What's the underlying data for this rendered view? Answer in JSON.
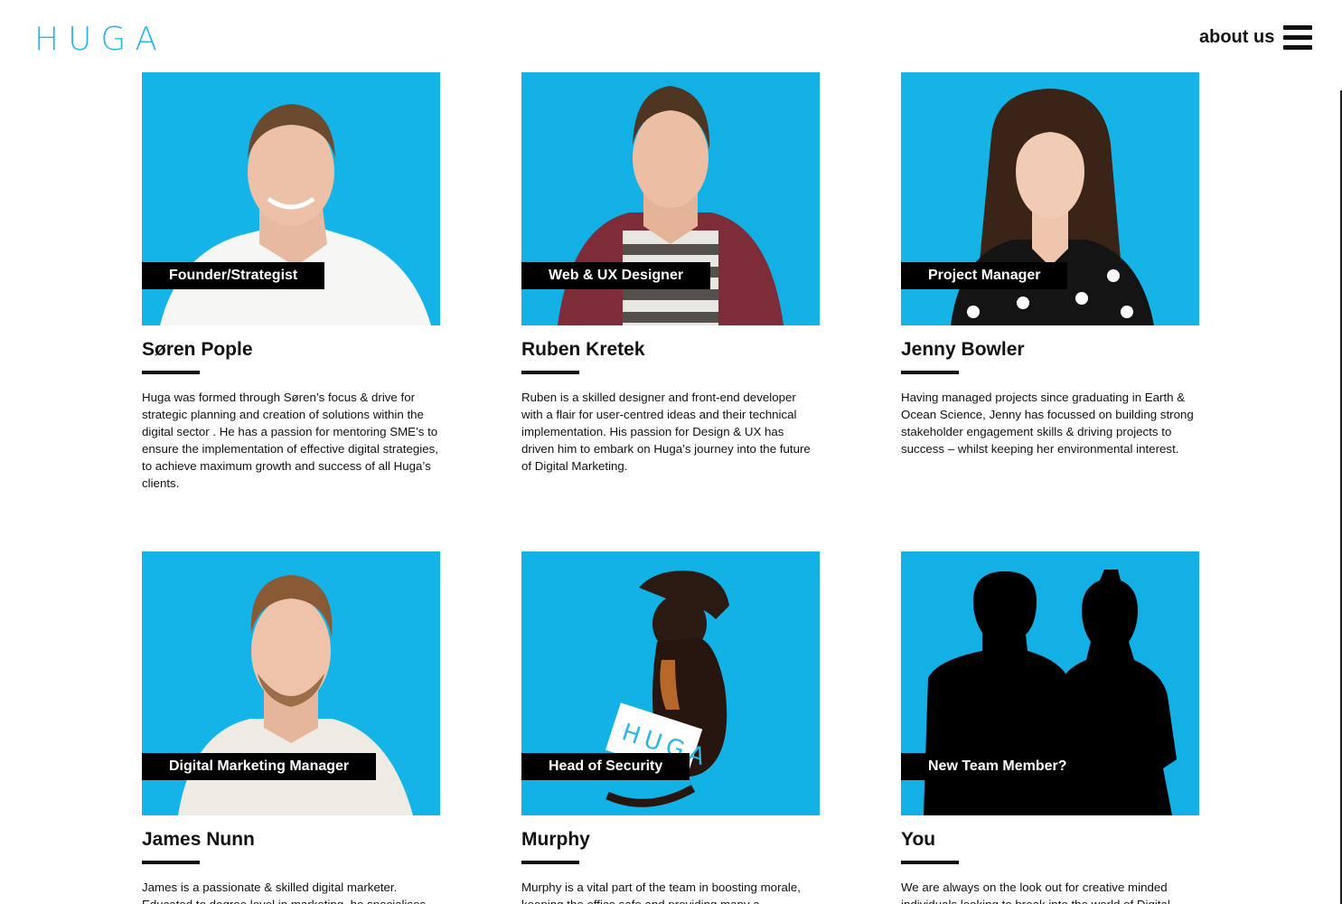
{
  "header": {
    "logo": "HUGA",
    "about_label": "about us",
    "menu_icon": "hamburger-menu-icon"
  },
  "colors": {
    "accent": "#29b6e6",
    "photo_bg": "#12b2e6",
    "text": "#111111"
  },
  "team": [
    {
      "role": "Founder/Strategist",
      "name": "Søren Pople",
      "bio": "Huga was formed through Søren’s focus & drive for strategic planning and creation of solutions within the digital sector . He has a passion for mentoring SME’s to ensure the implementation of effective digital strategies, to achieve maximum growth and success of all Huga’s clients."
    },
    {
      "role": "Web & UX Designer",
      "name": "Ruben Kretek",
      "bio": "Ruben is a skilled designer and front-end developer with a flair for user-centred ideas and their technical implementation. His passion for Design & UX has driven him to embark on Huga’s journey into the future of Digital Marketing."
    },
    {
      "role": "Project Manager",
      "name": "Jenny Bowler",
      "bio": "Having managed projects since graduating in Earth & Ocean Science, Jenny has focussed on building strong stakeholder engagement skills & driving projects to success – whilst keeping her environmental interest."
    },
    {
      "role": "Digital Marketing Manager",
      "name": "James Nunn",
      "bio": "James is a passionate & skilled digital marketer. Educated to degree level in marketing, he specialises"
    },
    {
      "role": "Head of Security",
      "name": "Murphy",
      "bio": "Murphy is a vital part of the team in boosting morale, keeping the office safe and providing many a"
    },
    {
      "role": "New Team Member?",
      "name": "You",
      "bio": "We are always on the look out for creative minded individuals looking to break into the world of Digital."
    }
  ],
  "photo_card_text": "HUGA"
}
